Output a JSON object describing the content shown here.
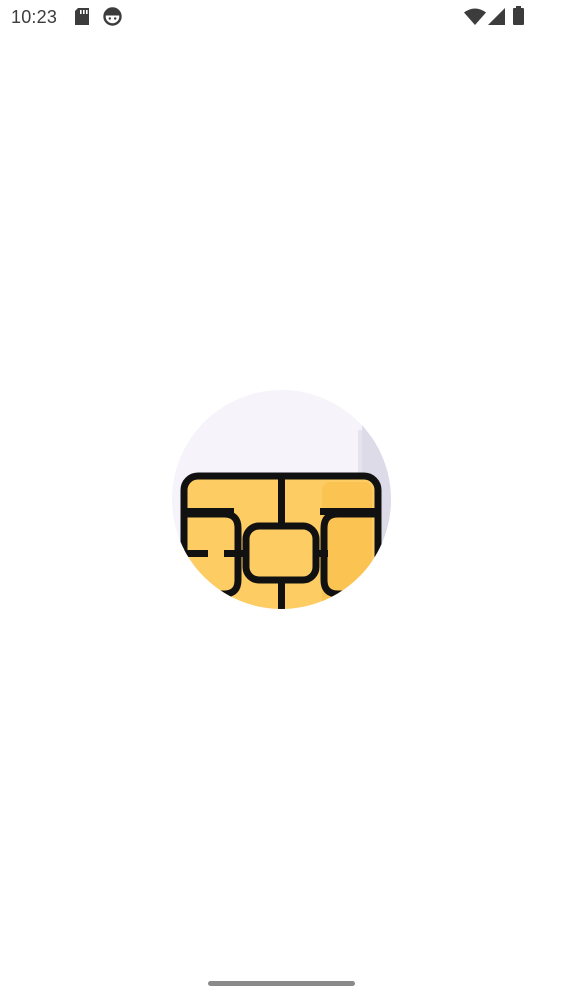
{
  "status_bar": {
    "time": "10:23",
    "left_icons": [
      "sd-card-icon",
      "android-face-icon"
    ],
    "right_icons": [
      "wifi-icon",
      "cell-signal-icon",
      "battery-icon"
    ],
    "icon_color": "#3c3c3c"
  },
  "splash": {
    "logo_icon": "sim-chip-icon",
    "colors": {
      "background": "#f6f4fa",
      "card_edge": "#dedbe9",
      "chip_fill": "#fdcd63",
      "chip_highlight": "#fbc352",
      "chip_outline": "#111111"
    }
  },
  "navigation": {
    "gesture_bar": "home-indicator"
  }
}
